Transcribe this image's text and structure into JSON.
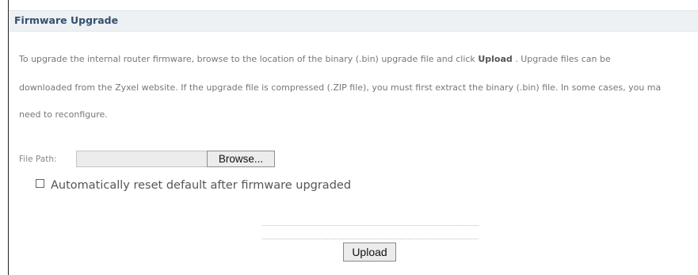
{
  "panel": {
    "title": "Firmware Upgrade"
  },
  "description": {
    "line1_before": "To upgrade the internal router firmware, browse to the location of the binary (.bin) upgrade file and click ",
    "line1_bold": "Upload",
    "line1_after": " . Upgrade files can be",
    "line2": "downloaded from the Zyxel website. If the upgrade file is compressed (.ZIP file), you must first extract the binary (.bin) file. In some cases, you ma",
    "line3": "need to reconfigure."
  },
  "file_path": {
    "label": "File Path:",
    "value": "",
    "browse_label": "Browse..."
  },
  "auto_reset": {
    "label": "Automatically reset default after firmware upgraded",
    "checked": false
  },
  "actions": {
    "upload_label": "Upload"
  }
}
